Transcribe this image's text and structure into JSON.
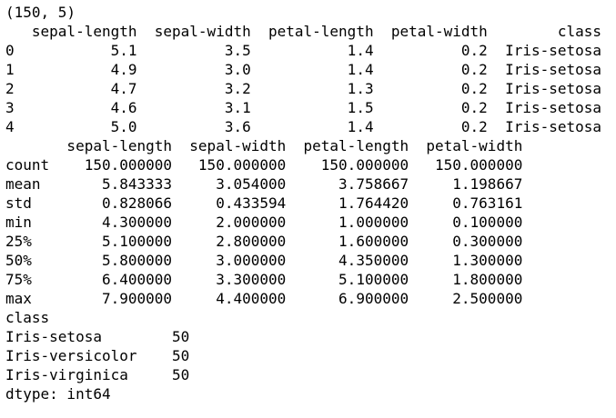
{
  "output": {
    "shape": "(150, 5)",
    "head": {
      "header": "   sepal-length  sepal-width  petal-length  petal-width        class",
      "rows": [
        "0           5.1          3.5           1.4          0.2  Iris-setosa",
        "1           4.9          3.0           1.4          0.2  Iris-setosa",
        "2           4.7          3.2           1.3          0.2  Iris-setosa",
        "3           4.6          3.1           1.5          0.2  Iris-setosa",
        "4           5.0          3.6           1.4          0.2  Iris-setosa"
      ]
    },
    "describe": {
      "header": "       sepal-length  sepal-width  petal-length  petal-width",
      "rows": [
        "count    150.000000   150.000000    150.000000   150.000000",
        "mean       5.843333     3.054000      3.758667     1.198667",
        "std        0.828066     0.433594      1.764420     0.763161",
        "min        4.300000     2.000000      1.000000     0.100000",
        "25%        5.100000     2.800000      1.600000     0.300000",
        "50%        5.800000     3.000000      4.350000     1.300000",
        "75%        6.400000     3.300000      5.100000     1.800000",
        "max        7.900000     4.400000      6.900000     2.500000"
      ]
    },
    "class_counts": {
      "header": "class",
      "rows": [
        "Iris-setosa        50",
        "Iris-versicolor    50",
        "Iris-virginica     50"
      ],
      "dtype": "dtype: int64"
    }
  }
}
